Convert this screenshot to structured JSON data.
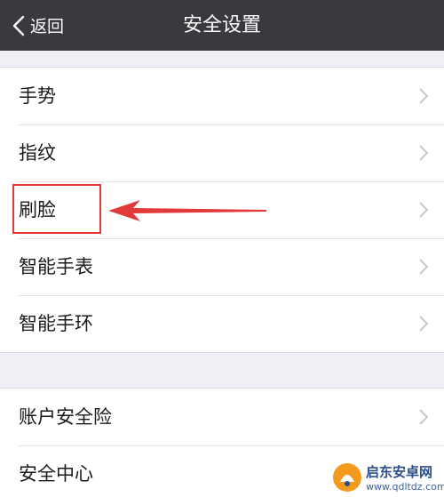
{
  "nav": {
    "back_label": "返回",
    "title": "安全设置"
  },
  "group1": {
    "items": [
      {
        "label": "手势"
      },
      {
        "label": "指纹"
      },
      {
        "label": "刷脸"
      },
      {
        "label": "智能手表"
      },
      {
        "label": "智能手环"
      }
    ]
  },
  "group2": {
    "items": [
      {
        "label": "账户安全险"
      },
      {
        "label": "安全中心"
      }
    ]
  },
  "annotation": {
    "highlighted_item": "刷脸",
    "color": "#e13a3a"
  },
  "watermark": {
    "name": "启东安卓网",
    "url": "www.qdltdz.com"
  },
  "colors": {
    "navbar": "#393a3f",
    "background": "#f0eff5",
    "chevron": "#c7c7cc"
  }
}
